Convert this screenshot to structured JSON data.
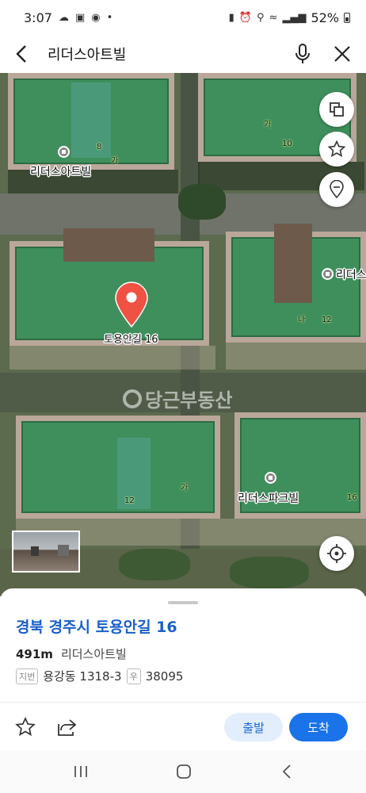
{
  "status_bar": {
    "time": "3:07",
    "battery": "52%",
    "icons": [
      "notification-icon",
      "gallery-icon",
      "chrome-icon",
      "dot-icon",
      "lock-icon",
      "alarm-icon",
      "location-icon",
      "wifi-icon",
      "signal-icon",
      "battery-icon"
    ]
  },
  "header": {
    "query": "리더스아트빌",
    "back_icon": "back-arrow-icon",
    "mic_icon": "mic-icon",
    "close_icon": "close-icon"
  },
  "map": {
    "labels": {
      "leaders_art_top": "리더스아트빌",
      "leaders_partial_right": "리더스",
      "pin_label": "토용안길 16",
      "leaders_park": "리더스파크빌"
    },
    "numbers": {
      "n8": "8",
      "ga_top_left": "가",
      "ga_top_right": "가",
      "n10": "10",
      "na": "나",
      "n12_right": "12",
      "ga_bottom": "가",
      "n12_bottom": "12",
      "n16": "16"
    },
    "watermark": "당근부동산",
    "buttons": [
      "layers-icon",
      "star-icon",
      "location-pin-icon",
      "my-location-icon"
    ]
  },
  "place": {
    "address": "경북 경주시 토용안길 16",
    "distance": "491m",
    "name": "리더스아트빌",
    "jibun_tag": "지번",
    "jibun": "용강동 1318-3",
    "postal_tag": "우",
    "postal": "38095"
  },
  "actions": {
    "depart": "출발",
    "arrive": "도착"
  },
  "colors": {
    "accent": "#1a73e8",
    "address_text": "#1a5fc8",
    "pin": "#ef5143",
    "roof_green": "#3f8f5d"
  }
}
